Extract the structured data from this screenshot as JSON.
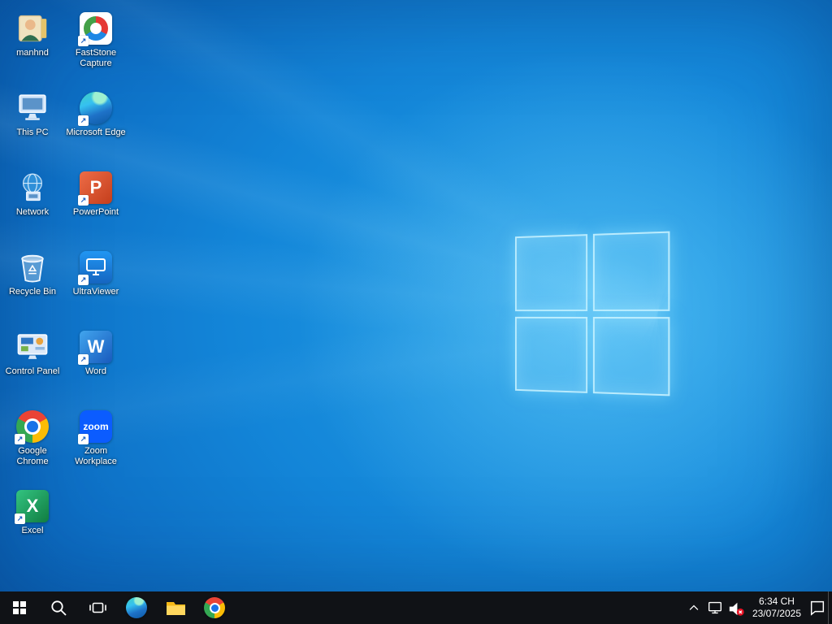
{
  "desktop": {
    "icons": [
      {
        "name": "manhnd",
        "label": "manhnd"
      },
      {
        "name": "this-pc",
        "label": "This PC"
      },
      {
        "name": "network",
        "label": "Network"
      },
      {
        "name": "recycle-bin",
        "label": "Recycle Bin"
      },
      {
        "name": "control-panel",
        "label": "Control Panel"
      },
      {
        "name": "google-chrome",
        "label": "Google Chrome"
      },
      {
        "name": "excel",
        "label": "Excel"
      },
      {
        "name": "faststone-capture",
        "label": "FastStone Capture"
      },
      {
        "name": "microsoft-edge",
        "label": "Microsoft Edge"
      },
      {
        "name": "powerpoint",
        "label": "PowerPoint"
      },
      {
        "name": "ultraviewer",
        "label": "UltraViewer"
      },
      {
        "name": "word",
        "label": "Word"
      },
      {
        "name": "zoom-workplace",
        "label": "Zoom Workplace"
      }
    ],
    "glyphs": {
      "powerpoint": "P",
      "word": "W",
      "excel": "X",
      "zoom": "zoom"
    }
  },
  "taskbar": {
    "buttons": [
      "start",
      "search",
      "task-view",
      "microsoft-edge",
      "file-explorer",
      "google-chrome"
    ],
    "tray": {
      "icons": [
        "chevron-up",
        "network",
        "volume-muted",
        "action-center",
        "show-desktop"
      ],
      "time": "6:34 CH",
      "date": "23/07/2025"
    }
  },
  "colors": {
    "wallpaper_accent": "#1385d8",
    "taskbar": "#101216",
    "word": "#185ABD",
    "excel": "#107C41",
    "powerpoint": "#C43E1C",
    "zoom": "#0b5cff",
    "chrome_blue": "#1a73e8",
    "mute_badge": "#e81123"
  }
}
